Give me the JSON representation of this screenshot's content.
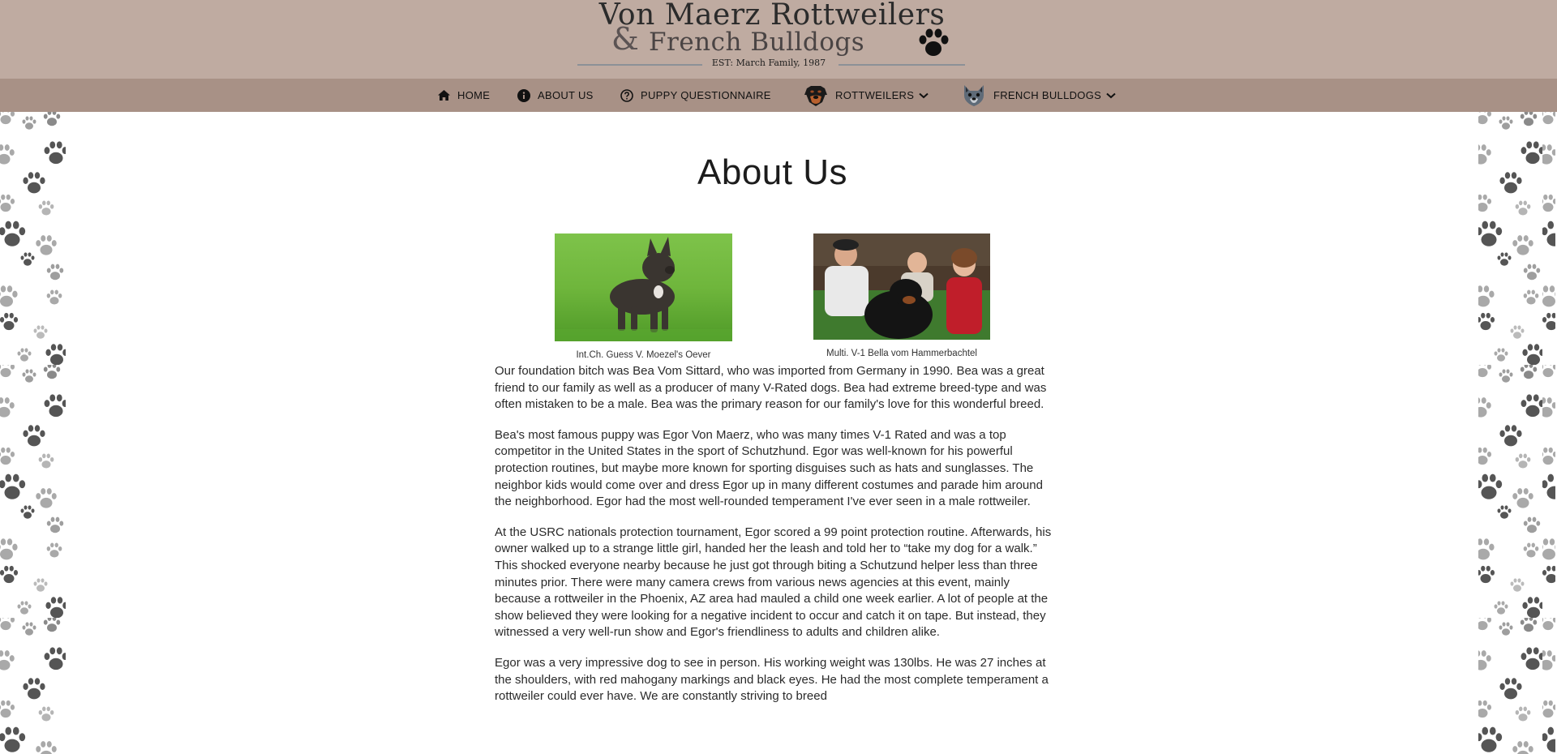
{
  "logo": {
    "line1": "Von Maerz Rottweilers",
    "ampersand": "&",
    "line2": "French Bulldogs",
    "established": "EST: March Family, 1987"
  },
  "nav": {
    "items": [
      {
        "label": "HOME",
        "icon": "home-icon"
      },
      {
        "label": "ABOUT US",
        "icon": "info-icon"
      },
      {
        "label": "PUPPY QUESTIONNAIRE",
        "icon": "question-icon"
      },
      {
        "label": "ROTTWEILERS",
        "icon": "rottweiler-face-icon",
        "dropdown": true
      },
      {
        "label": "FRENCH BULLDOGS",
        "icon": "french-bulldog-face-icon",
        "dropdown": true
      }
    ]
  },
  "page": {
    "title": "About Us"
  },
  "photos": [
    {
      "caption": "Int.Ch. Guess V. Moezel's Oever"
    },
    {
      "caption": "Multi. V-1 Bella vom Hammerbachtel"
    }
  ],
  "paragraphs": [
    "Our foundation bitch was Bea Vom Sittard, who was imported from Germany in 1990. Bea was a great friend to our family as well as a producer of many V-Rated dogs. Bea had extreme breed-type and was often mistaken to be a male. Bea was the primary reason for our family's love for this wonderful breed.",
    "Bea's most famous puppy was Egor Von Maerz, who was many times V-1 Rated and was a top competitor in the United States in the sport of Schutzhund. Egor was well-known for his powerful protection routines, but maybe more known for sporting disguises such as hats and sunglasses. The neighbor kids would come over and dress Egor up in many different costumes and parade him around the neighborhood. Egor had the most well-rounded temperament I've ever seen in a male rottweiler.",
    "At the USRC nationals protection tournament, Egor scored a 99 point protection routine. Afterwards, his owner walked up to a strange little girl, handed her the leash and told her to “take my dog for a walk.” This shocked everyone nearby because he just got through biting a Schutzund helper less than three minutes prior. There were many camera crews from various news agencies at this event, mainly because a rottweiler in the Phoenix, AZ area had mauled a child one week earlier. A lot of people at the show believed they were looking for a negative incident to occur and catch it on tape. But instead, they witnessed a very well-run show and Egor's friendliness to adults and children alike.",
    "Egor was a very impressive dog to see in person. His working weight was 130lbs. He was 27 inches at the shoulders, with red mahogany markings and black eyes. He had the most complete temperament a rottweiler could ever have. We are constantly striving to breed"
  ],
  "colors": {
    "header_bg": "#bfaba1",
    "nav_bg": "#a89186",
    "paw_dark": "#555555",
    "paw_light": "#a9a9a9"
  }
}
